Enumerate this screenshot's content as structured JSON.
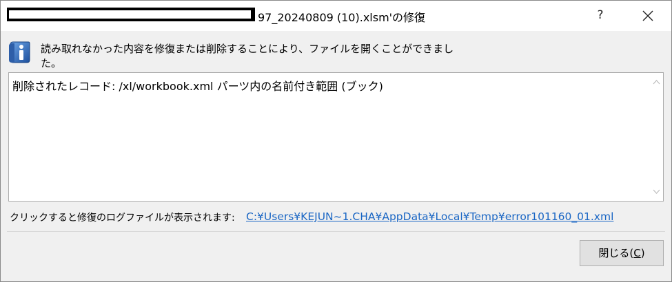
{
  "titlebar": {
    "title_suffix": "97_20240809 (10).xlsm'の修復",
    "help_label": "?",
    "close_icon": "close-icon"
  },
  "message": {
    "text": "読み取れなかった内容を修復または削除することにより、ファイルを開くことができました。",
    "icon": "info-icon"
  },
  "details": {
    "text": "削除されたレコード: /xl/workbook.xml パーツ内の名前付き範囲 (ブック)"
  },
  "log": {
    "label": "クリックすると修復のログファイルが表示されます:",
    "link": "C:¥Users¥KEJUN~1.CHA¥AppData¥Local¥Temp¥error101160_01.xml"
  },
  "buttons": {
    "close_label_main": "閉じる(",
    "close_mnemonic": "C",
    "close_label_end": ")"
  }
}
